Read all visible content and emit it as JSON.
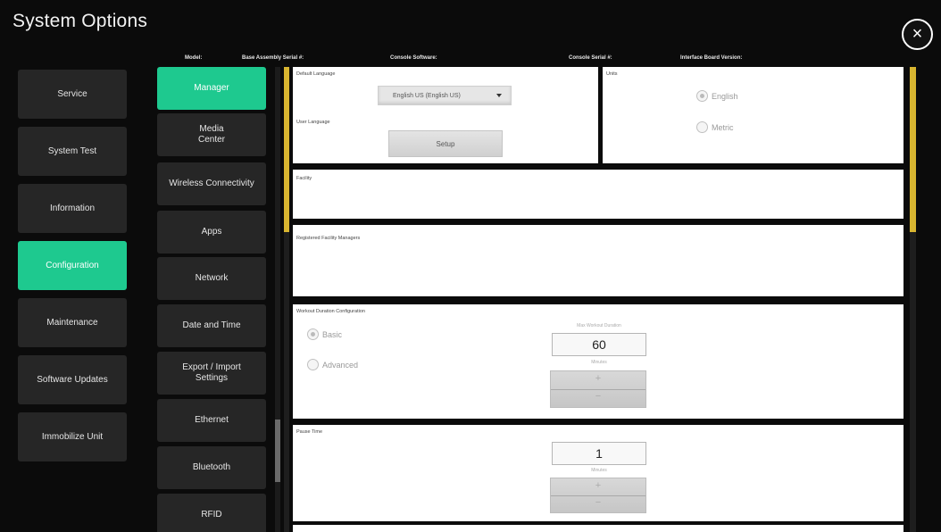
{
  "header": {
    "title": "System Options",
    "close_label": "×"
  },
  "info_bar": {
    "model_label": "Model:",
    "base_serial_label": "Base Assembly Serial #:",
    "console_software_label": "Console Software:",
    "console_serial_label": "Console Serial #:",
    "interface_board_label": "Interface Board Version:"
  },
  "nav": {
    "items": [
      {
        "label": "Service"
      },
      {
        "label": "System Test"
      },
      {
        "label": "Information"
      },
      {
        "label": "Configuration",
        "active": true
      },
      {
        "label": "Maintenance"
      },
      {
        "label": "Software Updates"
      },
      {
        "label": "Immobilize Unit"
      }
    ]
  },
  "subnav": {
    "items": [
      {
        "label": "Manager",
        "active": true
      },
      {
        "label": "Media\nCenter"
      },
      {
        "label": "Wireless Connectivity"
      },
      {
        "label": "Apps"
      },
      {
        "label": "Network"
      },
      {
        "label": "Date and Time"
      },
      {
        "label": "Export / Import\nSettings"
      },
      {
        "label": "Ethernet"
      },
      {
        "label": "Bluetooth"
      },
      {
        "label": "RFID"
      }
    ]
  },
  "language_panel": {
    "default_language_label": "Default Language",
    "default_language_value": "English US (English US)",
    "user_language_label": "User Language",
    "setup_label": "Setup"
  },
  "units_panel": {
    "label": "Units",
    "options": [
      "English",
      "Metric"
    ],
    "selected": "English"
  },
  "facility_panel": {
    "label": "Facility"
  },
  "registered_panel": {
    "label": "Registered Facility Managers"
  },
  "workout_panel": {
    "label": "Workout Duration Configuration",
    "options": [
      "Basic",
      "Advanced"
    ],
    "selected": "Basic",
    "max_label": "Max Workout Duration",
    "value": "60",
    "unit": "Minutes",
    "plus": "+",
    "minus": "−"
  },
  "pause_panel": {
    "label": "Pause Time",
    "value": "1",
    "unit": "Minutes",
    "plus": "+",
    "minus": "−"
  },
  "colors": {
    "accent": "#1ec98f",
    "scroll_accent": "#d8b530",
    "background": "#0b0b0b",
    "button": "#262626"
  }
}
